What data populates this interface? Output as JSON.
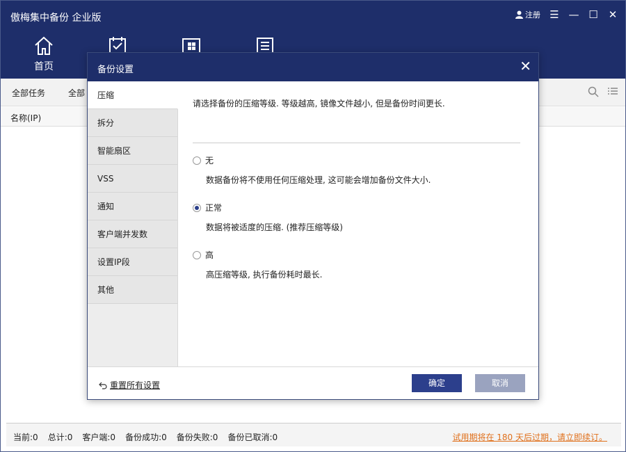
{
  "app": {
    "title": "傲梅集中备份 企业版",
    "register_label": "注册"
  },
  "nav": [
    {
      "label": "首页"
    },
    {
      "label": ""
    },
    {
      "label": ""
    },
    {
      "label": ""
    }
  ],
  "toolbar": {
    "tab_all_tasks": "全部任务",
    "tab_all_partial": "全部"
  },
  "table": {
    "col_name": "名称(IP)"
  },
  "status": {
    "current": "当前:0",
    "total": "总计:0",
    "clients": "客户端:0",
    "success": "备份成功:0",
    "failed": "备份失败:0",
    "cancelled": "备份已取消:0",
    "trial": "试用期将在 180 天后过期，请立即续订。"
  },
  "dialog": {
    "title": "备份设置",
    "sidebar": [
      {
        "label": "压缩"
      },
      {
        "label": "拆分"
      },
      {
        "label": "智能扇区"
      },
      {
        "label": "VSS"
      },
      {
        "label": "通知"
      },
      {
        "label": "客户端并发数"
      },
      {
        "label": "设置IP段"
      },
      {
        "label": "其他"
      }
    ],
    "description": "请选择备份的压缩等级. 等级越高, 镜像文件越小, 但是备份时间更长.",
    "options": [
      {
        "label": "无",
        "desc": "数据备份将不使用任何压缩处理, 这可能会增加备份文件大小.",
        "selected": false
      },
      {
        "label": "正常",
        "desc": "数据将被适度的压缩. (推荐压缩等级)",
        "selected": true
      },
      {
        "label": "高",
        "desc": "高压缩等级, 执行备份耗时最长.",
        "selected": false
      }
    ],
    "reset_label": "重置所有设置",
    "ok_label": "确定",
    "cancel_label": "取消"
  },
  "colors": {
    "header": "#1e2e6a",
    "ok_button": "#2c3f8c",
    "cancel_button": "#9aa3bf",
    "trial_text": "#e0701c"
  }
}
